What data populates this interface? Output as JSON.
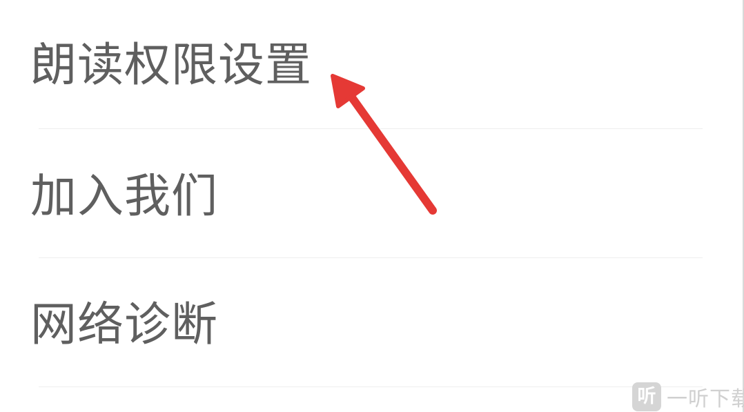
{
  "menu": {
    "items": [
      {
        "label": "朗读权限设置"
      },
      {
        "label": "加入我们"
      },
      {
        "label": "网络诊断"
      }
    ]
  },
  "annotation": {
    "arrow_color": "#e53935",
    "arrow_icon": "red-arrow-pointer-icon"
  },
  "watermark": {
    "logo_char": "听",
    "text": "一听下载"
  },
  "colors": {
    "label_text": "#5f5f5f",
    "divider": "#eeeeee",
    "background": "#ffffff"
  }
}
